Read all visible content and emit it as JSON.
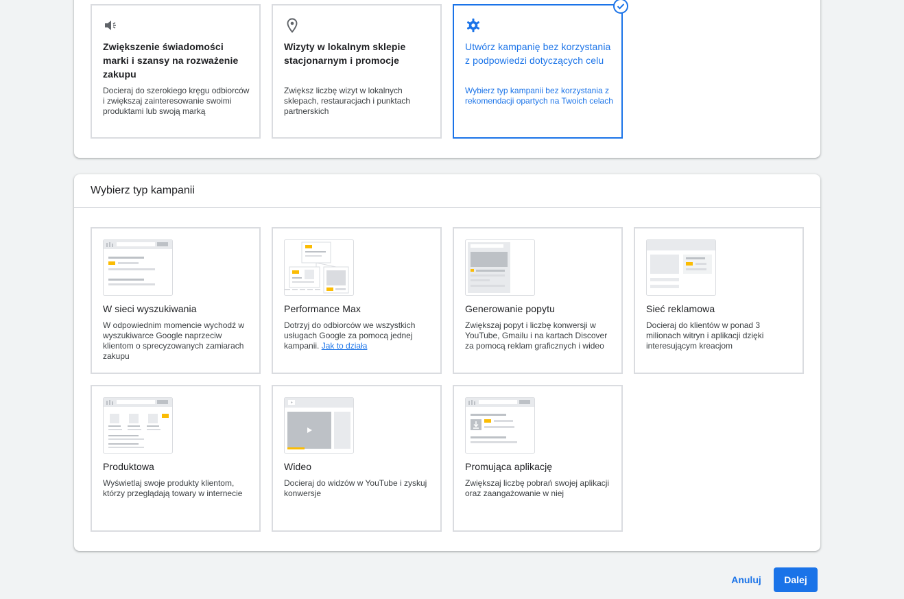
{
  "goals": [
    {
      "icon": "megaphone-icon",
      "title": "Zwiększenie świadomości marki i szansy na rozważenie zakupu",
      "desc": "Docieraj do szerokiego kręgu odbiorców i zwiększaj zainteresowanie swoimi produktami lub swoją marką"
    },
    {
      "icon": "location-pin-icon",
      "title": "Wizyty w lokalnym sklepie stacjonarnym i promocje",
      "desc": "Zwiększ liczbę wizyt w lokalnych sklepach, restauracjach i punktach partnerskich"
    },
    {
      "icon": "gear-icon",
      "title": "Utwórz kampanię bez korzystania z podpowiedzi dotyczących celu",
      "desc": "Wybierz typ kampanii bez korzystania z rekomendacji opartych na Twoich celach",
      "selected": true
    }
  ],
  "campaign_type": {
    "heading": "Wybierz typ kampanii",
    "cards": [
      {
        "title": "W sieci wyszukiwania",
        "desc": "W odpowiednim momencie wychodź w wyszukiwarce Google naprzeciw klientom o sprecyzowanych zamiarach zakupu"
      },
      {
        "title": "Performance Max",
        "desc": "Dotrzyj do odbiorców we wszystkich usługach Google za pomocą jednej kampanii.",
        "link": "Jak to działa"
      },
      {
        "title": "Generowanie popytu",
        "desc": "Zwiększaj popyt i liczbę konwersji w YouTube, Gmailu i na kartach Discover za pomocą reklam graficznych i wideo"
      },
      {
        "title": "Sieć reklamowa",
        "desc": "Docieraj do klientów w ponad 3 milionach witryn i aplikacji dzięki interesującym kreacjom"
      },
      {
        "title": "Produktowa",
        "desc": "Wyświetlaj swoje produkty klientom, którzy przeglądają towary w internecie"
      },
      {
        "title": "Wideo",
        "desc": "Docieraj do widzów w YouTube i zyskuj konwersje"
      },
      {
        "title": "Promująca aplikację",
        "desc": "Zwiększaj liczbę pobrań swojej aplikacji oraz zaangażowanie w niej"
      }
    ]
  },
  "footer": {
    "cancel_label": "Anuluj",
    "next_label": "Dalej"
  },
  "colors": {
    "accent": "#1a73e8",
    "highlight": "#fbbc04",
    "border": "#dadce0"
  }
}
